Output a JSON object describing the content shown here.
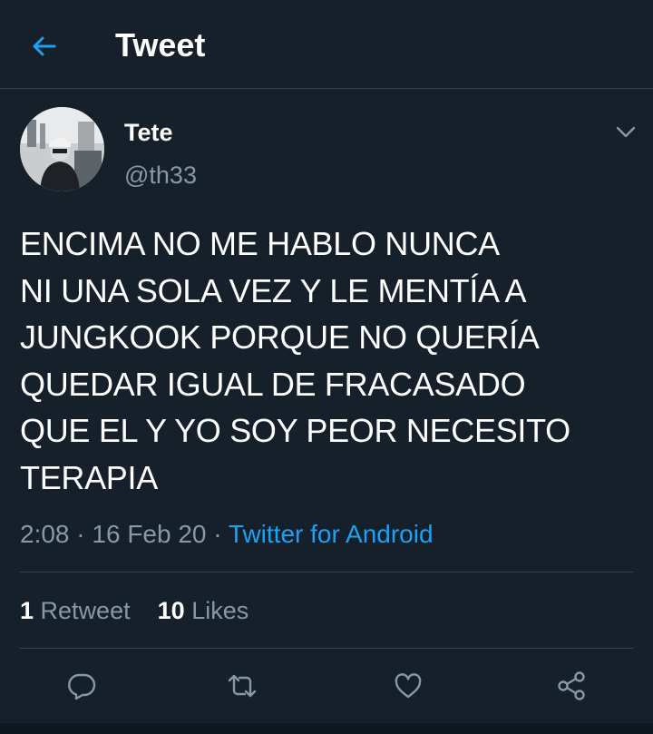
{
  "header": {
    "title": "Tweet",
    "back_icon": "arrow-left-icon"
  },
  "colors": {
    "background": "#15202b",
    "accent": "#1da1f2",
    "muted_text": "#8899a6",
    "divider": "#38444d"
  },
  "tweet": {
    "author_name": "Tete",
    "author_handle": "@th33",
    "text_lines": [
      "ENCIMA NO ME HABLO NUNCA",
      "NI UNA SOLA VEZ Y LE MENTÍA A",
      "JUNGKOOK PORQUE NO QUERÍA",
      "QUEDAR IGUAL DE FRACASADO",
      "QUE EL Y YO SOY PEOR NECESITO",
      "TERAPIA"
    ],
    "time": "2:08",
    "separator": " · ",
    "date": "16 Feb 20",
    "source": "Twitter for Android"
  },
  "stats": {
    "retweets_count": "1",
    "retweets_label": "Retweet",
    "likes_count": "10",
    "likes_label": "Likes"
  },
  "actions": [
    {
      "icon": "reply-icon"
    },
    {
      "icon": "retweet-icon"
    },
    {
      "icon": "like-icon"
    },
    {
      "icon": "share-icon"
    }
  ]
}
